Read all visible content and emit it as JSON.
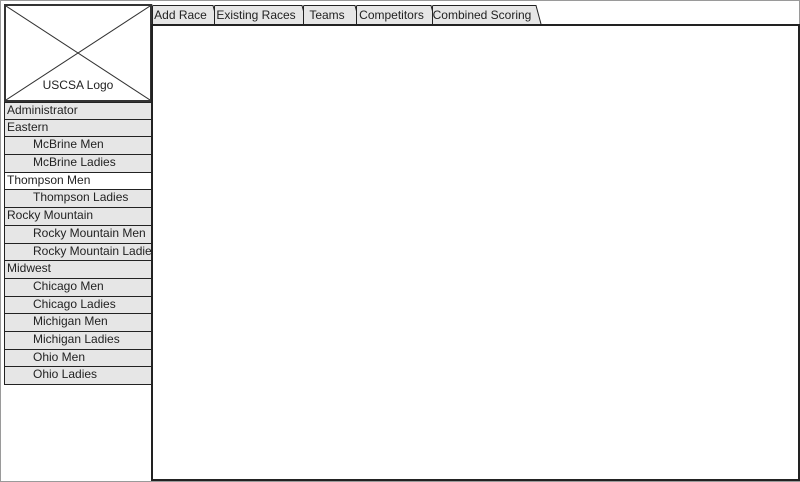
{
  "logo": {
    "label": "USCSA Logo"
  },
  "nav": {
    "items": [
      {
        "label": "Administrator",
        "level": 0,
        "selected": false
      },
      {
        "label": "Eastern",
        "level": 0,
        "selected": false
      },
      {
        "label": "McBrine Men",
        "level": 1,
        "selected": false
      },
      {
        "label": "McBrine Ladies",
        "level": 1,
        "selected": false
      },
      {
        "label": "Thompson Men",
        "level": 0,
        "selected": true
      },
      {
        "label": "Thompson Ladies",
        "level": 1,
        "selected": false
      },
      {
        "label": "Rocky Mountain",
        "level": 0,
        "selected": false
      },
      {
        "label": "Rocky Mountain Men",
        "level": 1,
        "selected": false
      },
      {
        "label": "Rocky Mountain Ladies",
        "level": 1,
        "selected": false
      },
      {
        "label": "Midwest",
        "level": 0,
        "selected": false
      },
      {
        "label": "Chicago Men",
        "level": 1,
        "selected": false
      },
      {
        "label": "Chicago Ladies",
        "level": 1,
        "selected": false
      },
      {
        "label": "Michigan Men",
        "level": 1,
        "selected": false
      },
      {
        "label": "Michigan Ladies",
        "level": 1,
        "selected": false
      },
      {
        "label": "Ohio Men",
        "level": 1,
        "selected": false
      },
      {
        "label": "Ohio Ladies",
        "level": 1,
        "selected": false
      }
    ]
  },
  "tabs": [
    {
      "label": "Add Race"
    },
    {
      "label": "Existing Races"
    },
    {
      "label": "Teams"
    },
    {
      "label": "Competitors"
    },
    {
      "label": "Combined Scoring"
    }
  ],
  "colors": {
    "tab_fill": "#e6e6e6",
    "nav_fill": "#e6e6e6",
    "nav_selected_fill": "#ffffff",
    "border": "#222222"
  }
}
